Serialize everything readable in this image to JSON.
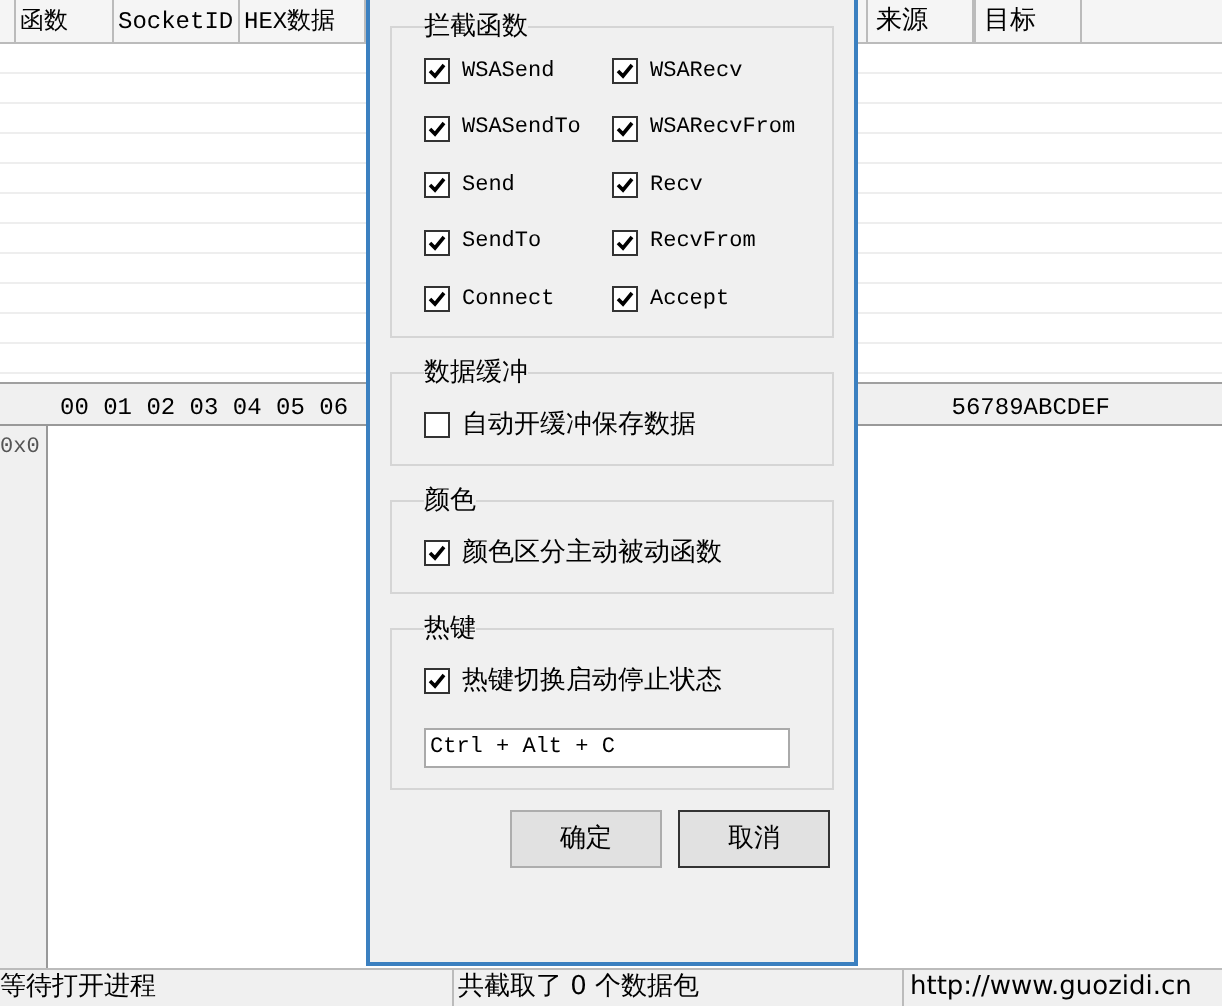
{
  "table": {
    "columns": [
      "函数",
      "SocketID",
      "HEX数据",
      "来源",
      "目标"
    ]
  },
  "hex_view": {
    "header_left": "00 01 02 03 04 05 06",
    "header_right": "56789ABCDEF",
    "row_label": "0x0"
  },
  "dialog": {
    "groups": [
      {
        "kind": "grid",
        "title": "拦截函数",
        "items": [
          {
            "label": "WSASend",
            "checked": true
          },
          {
            "label": "WSARecv",
            "checked": true
          },
          {
            "label": "WSASendTo",
            "checked": true
          },
          {
            "label": "WSARecvFrom",
            "checked": true
          },
          {
            "label": "Send",
            "checked": true
          },
          {
            "label": "Recv",
            "checked": true
          },
          {
            "label": "SendTo",
            "checked": true
          },
          {
            "label": "RecvFrom",
            "checked": true
          },
          {
            "label": "Connect",
            "checked": true
          },
          {
            "label": "Accept",
            "checked": true
          }
        ]
      },
      {
        "kind": "single",
        "title": "数据缓冲",
        "items": [
          {
            "label": "自动开缓冲保存数据",
            "checked": false
          }
        ]
      },
      {
        "kind": "single",
        "title": "颜色",
        "items": [
          {
            "label": "颜色区分主动被动函数",
            "checked": true
          }
        ]
      },
      {
        "kind": "hotkey",
        "title": "热键",
        "items": [
          {
            "label": "热键切换启动停止状态",
            "checked": true
          }
        ],
        "value": "Ctrl + Alt + C"
      }
    ],
    "buttons": [
      "确定",
      "取消"
    ]
  },
  "status_bar": [
    "等待打开进程",
    "共截取了 0 个数据包",
    "http://www.guozidi.cn"
  ]
}
